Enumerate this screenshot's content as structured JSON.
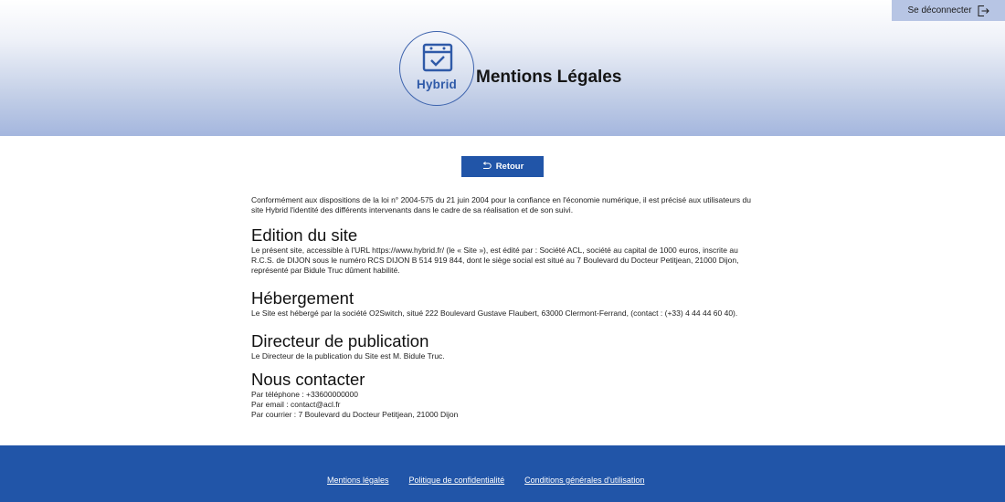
{
  "header": {
    "logout_label": "Se déconnecter",
    "logo_text": "Hybrid",
    "page_title": "Mentions Légales"
  },
  "back_button": {
    "label": "Retour"
  },
  "intro": "Conformément aux dispositions de la loi n° 2004-575 du 21 juin 2004 pour la confiance en l'économie numérique, il est précisé aux utilisateurs du site Hybrid l'identité des différents intervenants dans le cadre de sa réalisation et de son suivi.",
  "sections": [
    {
      "title": "Edition du site",
      "lines": [
        "Le présent site, accessible à l'URL https://www.hybrid.fr/ (le « Site »), est édité par : Société ACL, société au capital de 1000 euros, inscrite au R.C.S. de DIJON sous le numéro RCS DIJON B 514 919 844, dont le siège social est situé au 7 Boulevard du Docteur Petitjean, 21000 Dijon, représenté par Bidule Truc dûment habilité."
      ]
    },
    {
      "title": "Hébergement",
      "lines": [
        "Le Site est hébergé par la société O2Switch, situé 222 Boulevard Gustave Flaubert, 63000 Clermont-Ferrand, (contact : (+33) 4 44 44 60 40)."
      ]
    },
    {
      "title": "Directeur de publication",
      "lines": [
        "Le Directeur de la publication du Site est M. Bidule Truc."
      ]
    },
    {
      "title": "Nous contacter",
      "lines": [
        "Par téléphone : +33600000000",
        "Par email : contact@acl.fr",
        "Par courrier : 7 Boulevard du Docteur Petitjean, 21000 Dijon"
      ]
    }
  ],
  "footer": {
    "links": [
      "Mentions légales",
      "Politique de confidentialité",
      "Conditions générales d'utilisation"
    ]
  },
  "colors": {
    "primary": "#2155a8",
    "logo_blue": "#3d63ad",
    "logout_bg": "#b7c5e4"
  },
  "icons": {
    "logout": "logout-icon",
    "back": "undo-arrow-icon",
    "logo": "calendar-check-icon"
  }
}
